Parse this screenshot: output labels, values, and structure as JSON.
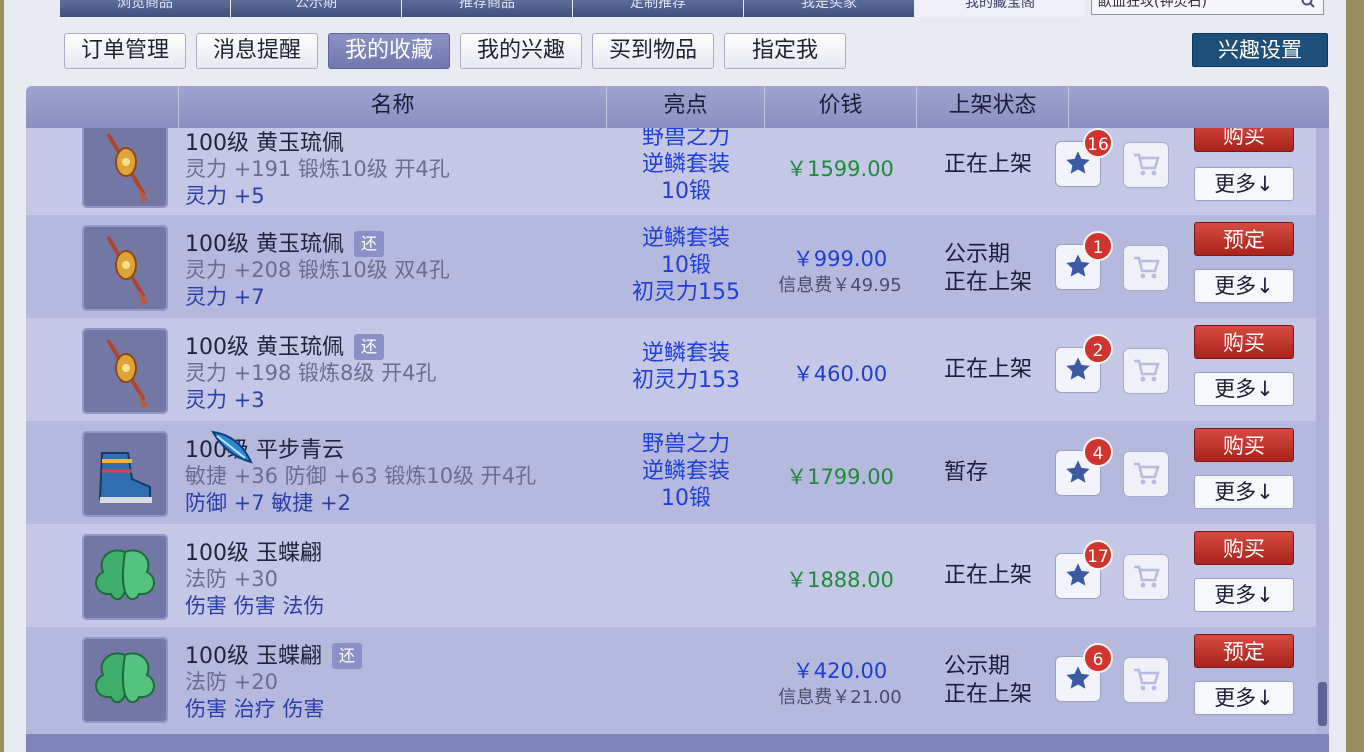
{
  "top_tabs": [
    {
      "label": "浏览商品"
    },
    {
      "label": "公示期"
    },
    {
      "label": "推荐商品"
    },
    {
      "label": "定制推荐"
    },
    {
      "label": "我是买家"
    },
    {
      "label": "我的藏宝阁",
      "active": true
    }
  ],
  "top_search": {
    "value": "歃血狂攻(钟灵石)"
  },
  "subnav": [
    {
      "label": "订单管理"
    },
    {
      "label": "消息提醒"
    },
    {
      "label": "我的收藏",
      "active": true
    },
    {
      "label": "我的兴趣"
    },
    {
      "label": "买到物品"
    },
    {
      "label": "指定我"
    }
  ],
  "interest_settings_label": "兴趣设置",
  "table": {
    "headers": {
      "name": "名称",
      "highlight": "亮点",
      "price": "价钱",
      "status": "上架状态"
    },
    "rows": [
      {
        "title": "100级 黄玉琉佩",
        "badge": "",
        "line2": "灵力 +191 锻炼10级 开4孔",
        "line3": "灵力 +5",
        "hl": [
          "野兽之力",
          "逆鳞套装",
          "10锻"
        ],
        "price": "￥1599.00",
        "price_color": "green",
        "fee": "",
        "status": [
          "正在上架"
        ],
        "fav_count": "16",
        "action": "购买",
        "more": "更多↓",
        "icon": "yellow-jade-pendant"
      },
      {
        "title": "100级 黄玉琉佩",
        "badge": "还",
        "line2": "灵力 +208 锻炼10级 双4孔",
        "line3": "灵力 +7",
        "hl": [
          "逆鳞套装",
          "10锻",
          "初灵力155"
        ],
        "price": "￥999.00",
        "price_color": "blue",
        "fee": "信息费￥49.95",
        "status": [
          "公示期",
          "正在上架"
        ],
        "fav_count": "1",
        "action": "预定",
        "more": "更多↓",
        "icon": "yellow-jade-pendant"
      },
      {
        "title": "100级 黄玉琉佩",
        "badge": "还",
        "line2": "灵力 +198 锻炼8级 开4孔",
        "line3": "灵力 +3",
        "hl": [
          "逆鳞套装",
          "初灵力153"
        ],
        "price": "￥460.00",
        "price_color": "blue",
        "fee": "",
        "status": [
          "正在上架"
        ],
        "fav_count": "2",
        "action": "购买",
        "more": "更多↓",
        "icon": "yellow-jade-pendant"
      },
      {
        "title": "100级 平步青云",
        "badge": "",
        "line2": "敏捷 +36 防御 +63 锻炼10级 开4孔",
        "line3": "防御 +7 敏捷 +2",
        "hl": [
          "野兽之力",
          "逆鳞套装",
          "10锻"
        ],
        "price": "￥1799.00",
        "price_color": "green",
        "fee": "",
        "status": [
          "暂存"
        ],
        "fav_count": "4",
        "action": "购买",
        "more": "更多↓",
        "icon": "boots"
      },
      {
        "title": "100级 玉蝶翩",
        "badge": "",
        "line2": "法防 +30",
        "line3": "伤害 伤害 法伤",
        "hl": [],
        "price": "￥1888.00",
        "price_color": "green",
        "fee": "",
        "status": [
          "正在上架"
        ],
        "fav_count": "17",
        "action": "购买",
        "more": "更多↓",
        "icon": "jade-butterfly"
      },
      {
        "title": "100级 玉蝶翩",
        "badge": "还",
        "line2": "法防 +20",
        "line3": "伤害 治疗 伤害",
        "hl": [],
        "price": "￥420.00",
        "price_color": "blue",
        "fee": "信息费￥21.00",
        "status": [
          "公示期",
          "正在上架"
        ],
        "fav_count": "6",
        "action": "预定",
        "more": "更多↓",
        "icon": "jade-butterfly"
      }
    ]
  },
  "colors": {
    "buy": "#c0332a",
    "price_green": "#1f8a3a",
    "price_blue": "#1f3fd0",
    "header": "#8a8fc0"
  }
}
